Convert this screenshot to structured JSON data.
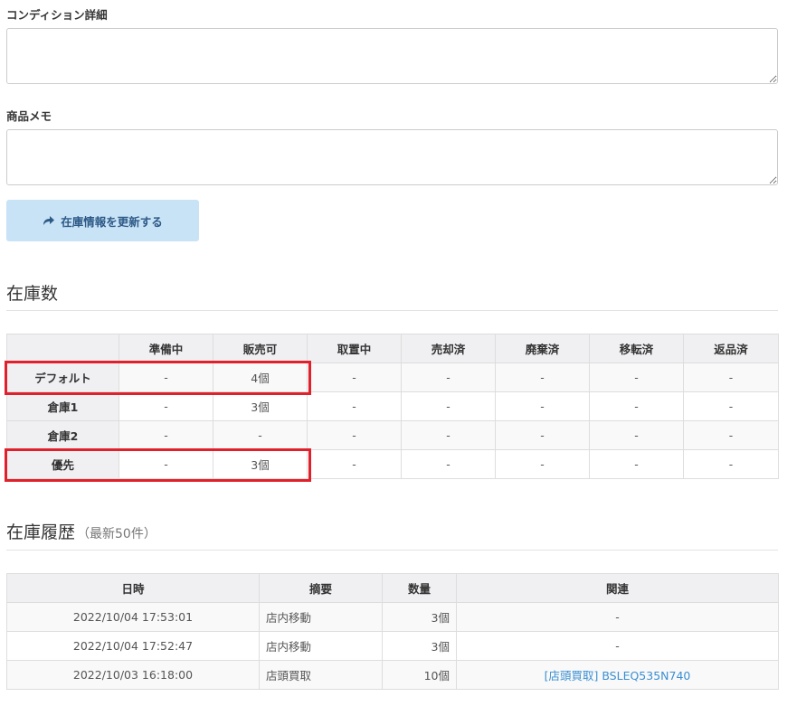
{
  "condition": {
    "label": "コンディション詳細",
    "value": ""
  },
  "memo": {
    "label": "商品メモ",
    "value": ""
  },
  "update_button": {
    "label": "在庫情報を更新する"
  },
  "stock": {
    "title": "在庫数",
    "columns": [
      "",
      "準備中",
      "販売可",
      "取置中",
      "売却済",
      "廃棄済",
      "移転済",
      "返品済"
    ],
    "rows": [
      {
        "name": "デフォルト",
        "cells": [
          "-",
          "4個",
          "-",
          "-",
          "-",
          "-",
          "-"
        ]
      },
      {
        "name": "倉庫1",
        "cells": [
          "-",
          "3個",
          "-",
          "-",
          "-",
          "-",
          "-"
        ]
      },
      {
        "name": "倉庫2",
        "cells": [
          "-",
          "-",
          "-",
          "-",
          "-",
          "-",
          "-"
        ]
      },
      {
        "name": "優先",
        "cells": [
          "-",
          "3個",
          "-",
          "-",
          "-",
          "-",
          "-"
        ]
      }
    ]
  },
  "history": {
    "title": "在庫履歴",
    "subtitle": "（最新50件）",
    "columns": [
      "日時",
      "摘要",
      "数量",
      "関連"
    ],
    "rows": [
      {
        "datetime": "2022/10/04 17:53:01",
        "summary": "店内移動",
        "qty": "3個",
        "related": "-"
      },
      {
        "datetime": "2022/10/04 17:52:47",
        "summary": "店内移動",
        "qty": "3個",
        "related": "-"
      },
      {
        "datetime": "2022/10/03 16:18:00",
        "summary": "店頭買取",
        "qty": "10個",
        "related": "[店頭買取] BSLEQ535N740"
      }
    ]
  },
  "colors": {
    "highlight": "#e0202a",
    "button_bg": "#c8e2f6",
    "button_text": "#2d5a86",
    "link": "#3a8fd2"
  },
  "icons": {
    "update_button": "share-arrow-icon"
  }
}
